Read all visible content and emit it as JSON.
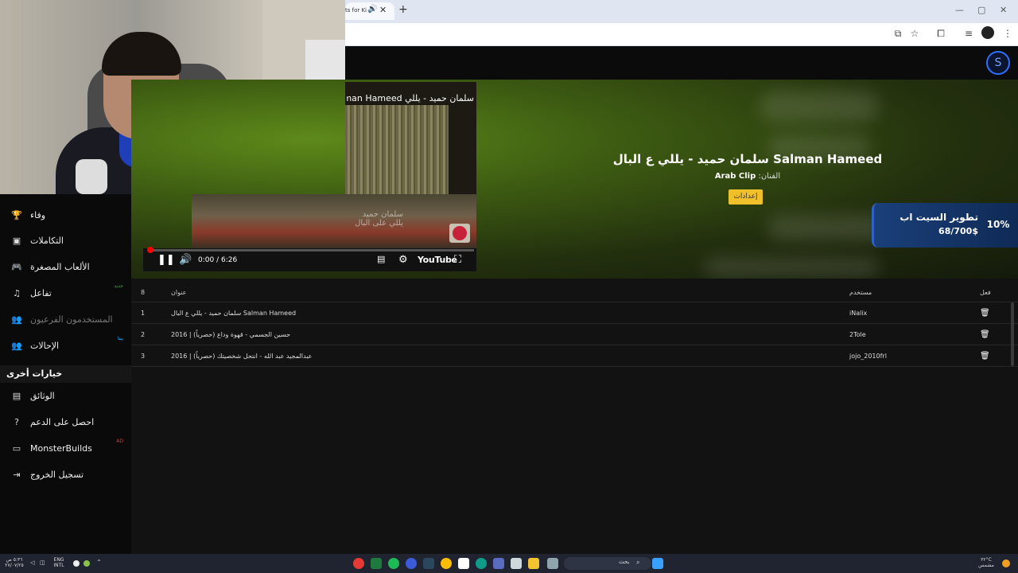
{
  "browser": {
    "tab_label": "ts for Ki",
    "tab_close": "✕",
    "new_tab": "+",
    "window_controls": [
      "—",
      "▢",
      "✕"
    ],
    "toolbar_icons": [
      "translate-icon",
      "star-icon",
      "extensions-icon",
      "media-control-icon",
      "profile-avatar",
      "kebab-menu-icon"
    ]
  },
  "banner": {
    "song_title": "سلمان حميد - يللي ع البال Salman Hameed",
    "artist_label": "الفنان:",
    "artist_name": "Arab Clip",
    "settings_button": "إعدادات",
    "goal": {
      "title": "تطوير السيت اب",
      "amount": "68/700$",
      "percent": "10%",
      "percent_value": 10
    }
  },
  "video": {
    "title": "سلمان حميد - يللي Salman Hameed",
    "overlay_text": "سلمان حميد\nيللي على البال",
    "time": "0:00 / 6:26",
    "youtube": "YouTube",
    "progress": 0
  },
  "sidebar": {
    "items": [
      {
        "icon": "🏆",
        "icon_name": "trophy-icon",
        "label": "وفاء",
        "badge": ""
      },
      {
        "icon": "▣",
        "icon_name": "integrations-icon",
        "label": "التكاملات",
        "badge": ""
      },
      {
        "icon": "🎮",
        "icon_name": "gamepad-icon",
        "label": "الألعاب المصغرة",
        "badge": ""
      },
      {
        "icon": "♫",
        "icon_name": "music-icon",
        "label": "تفاعل",
        "badge": "جديد"
      },
      {
        "icon": "👥",
        "icon_name": "users-icon",
        "label": "المستخدمون الفرعيون",
        "badge": ""
      },
      {
        "icon": "👥",
        "icon_name": "referrals-icon",
        "label": "الإحالات",
        "badge": "بيتا"
      }
    ],
    "other_heading": "خيارات أخرى",
    "other_items": [
      {
        "icon": "▤",
        "icon_name": "docs-icon",
        "label": "الوثائق",
        "badge": ""
      },
      {
        "icon": "?",
        "icon_name": "help-icon",
        "label": "احصل على الدعم",
        "badge": ""
      },
      {
        "icon": "▭",
        "icon_name": "monitor-icon",
        "label": "MonsterBuilds",
        "badge": "AD"
      },
      {
        "icon": "⇥",
        "icon_name": "logout-icon",
        "label": "تسجيل الخروج",
        "badge": ""
      }
    ]
  },
  "table": {
    "headers": {
      "num": "8",
      "title": "عنوان",
      "user": "مستخدم",
      "action": "فعل"
    },
    "rows": [
      {
        "num": "1",
        "title": "سلمان حميد - يللي ع البال Salman Hameed",
        "user": "iNalix"
      },
      {
        "num": "2",
        "title": "حسين الجسمي - قهوة وداع (حصرياً) | 2016",
        "user": "2Tole"
      },
      {
        "num": "3",
        "title": "عبدالمجيد عبد الله - انتحل شخصيتك (حصرياً) | 2016",
        "user": "jojo_2010frl"
      }
    ]
  },
  "taskbar": {
    "lang": "ENG\nINTL",
    "time": "٥:٣٦ ص\n٢٧/٠٧/٢٥",
    "search_placeholder": "بحث",
    "weather": "٣٢°C\nمشمس",
    "weather_text": "٣٢°C مشمس"
  }
}
